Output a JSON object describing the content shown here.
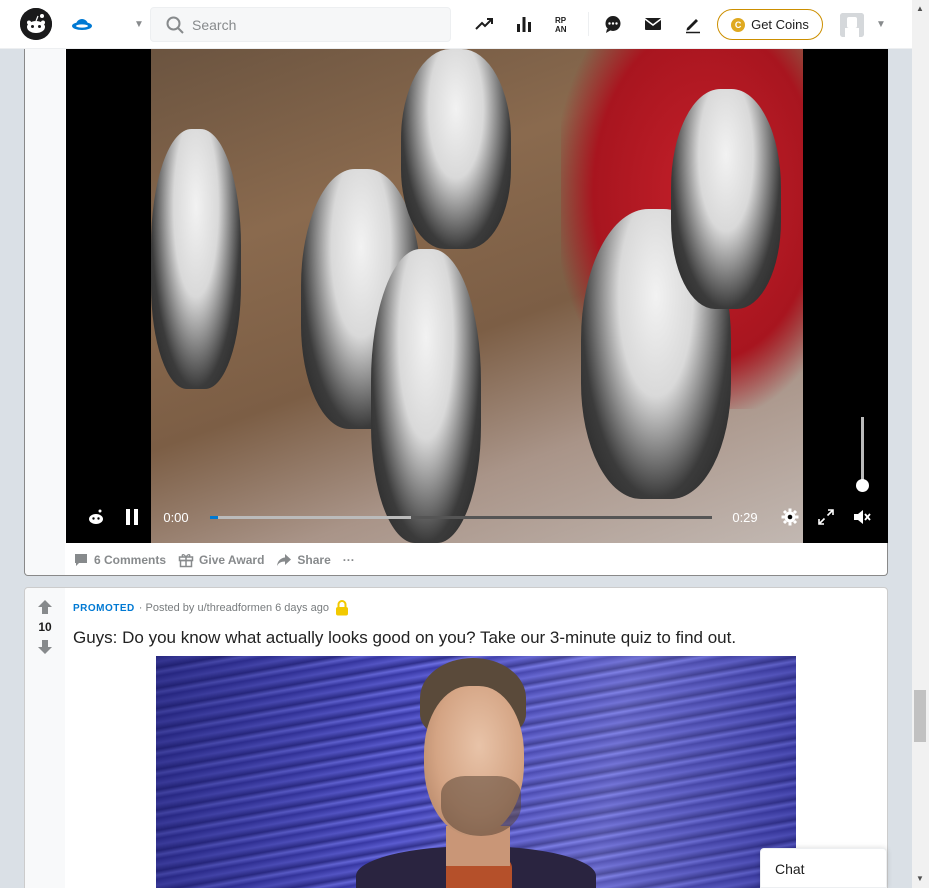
{
  "header": {
    "search_placeholder": "Search",
    "get_coins_label": "Get Coins",
    "coin_glyph": "C",
    "icons": [
      "reddit-logo-icon",
      "feed-icon",
      "popular-icon",
      "all-icon",
      "rpan-icon",
      "chat-icon",
      "mail-icon",
      "create-post-icon",
      "coins-icon",
      "user-avatar-icon"
    ]
  },
  "post1": {
    "video": {
      "current_time": "0:00",
      "duration": "0:29",
      "played_fraction": 0.01,
      "buffered_fraction": 0.4,
      "muted": true
    },
    "actions": {
      "comments_label": "6 Comments",
      "award_label": "Give Award",
      "share_label": "Share",
      "more_label": "···"
    }
  },
  "post2": {
    "vote_count": "10",
    "promoted_label": "PROMOTED",
    "posted_by": "· Posted by u/threadformen 6 days ago",
    "title": "Guys: Do you know what actually looks good on you? Take our 3-minute quiz to find out."
  },
  "chat": {
    "label": "Chat"
  },
  "colors": {
    "accent": "#0079d3",
    "coins_border": "#cc8f00",
    "text_meta": "#878a8c"
  }
}
